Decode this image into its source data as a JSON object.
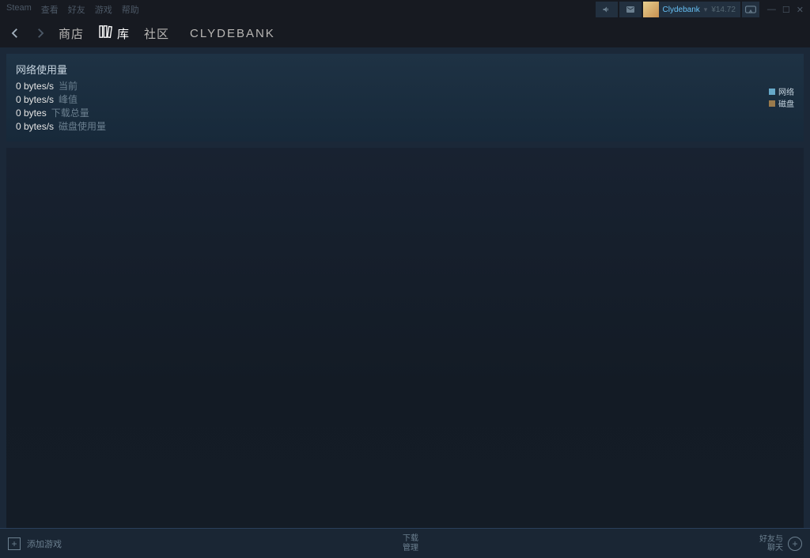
{
  "topMenu": {
    "items": [
      "Steam",
      "查看",
      "好友",
      "游戏",
      "帮助"
    ]
  },
  "user": {
    "name": "Clydebank",
    "balance": "¥14.72"
  },
  "nav": {
    "store": "商店",
    "library": "库",
    "community": "社区",
    "profile": "CLYDEBANK"
  },
  "stats": {
    "title": "网络使用量",
    "rows": [
      {
        "val": "0 bytes/s",
        "label": "当前"
      },
      {
        "val": "0 bytes/s",
        "label": "峰值"
      },
      {
        "val": "0 bytes",
        "label": "下载总量"
      },
      {
        "val": "0 bytes/s",
        "label": "磁盘使用量"
      }
    ],
    "legend": {
      "net": "网络",
      "disk": "磁盘"
    }
  },
  "bottom": {
    "addGame": "添加游戏",
    "downloads": "下载",
    "manage": "管理",
    "friendsChat1": "好友与",
    "friendsChat2": "聊天"
  }
}
